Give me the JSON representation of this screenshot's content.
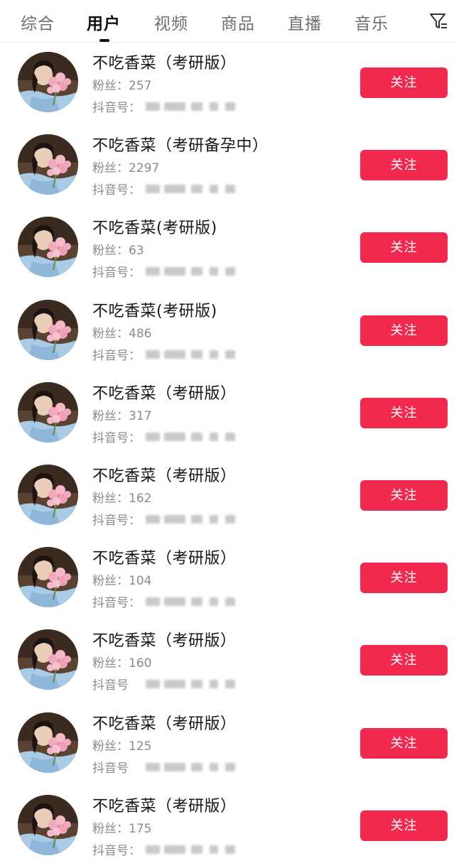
{
  "tabs": [
    {
      "label": "综合",
      "active": false
    },
    {
      "label": "用户",
      "active": true
    },
    {
      "label": "视频",
      "active": false
    },
    {
      "label": "商品",
      "active": false
    },
    {
      "label": "直播",
      "active": false
    },
    {
      "label": "音乐",
      "active": false
    }
  ],
  "filter_icon": "filter-icon",
  "follow_label": "关注",
  "colors": {
    "accent": "#f1294f",
    "text_primary": "#161616",
    "text_secondary": "#8a8a8a"
  },
  "users": [
    {
      "name": "不吃香菜（考研版）",
      "fans": "粉丝：257",
      "douyin_prefix": "抖音号："
    },
    {
      "name": "不吃香菜（考研备孕中）",
      "fans": "粉丝：2297",
      "douyin_prefix": "抖音号："
    },
    {
      "name": "不吃香菜(考研版)",
      "fans": "粉丝：63",
      "douyin_prefix": "抖音号："
    },
    {
      "name": "不吃香菜(考研版)",
      "fans": "粉丝：486",
      "douyin_prefix": "抖音号："
    },
    {
      "name": "不吃香菜（考研版）",
      "fans": "粉丝：317",
      "douyin_prefix": "抖音号："
    },
    {
      "name": "不吃香菜（考研版）",
      "fans": "粉丝：162",
      "douyin_prefix": "抖音号："
    },
    {
      "name": "不吃香菜（考研版）",
      "fans": "粉丝：104",
      "douyin_prefix": "抖音号："
    },
    {
      "name": "不吃香菜（考研版）",
      "fans": "粉丝：160",
      "douyin_prefix": "抖音号"
    },
    {
      "name": "不吃香菜（考研版）",
      "fans": "粉丝：125",
      "douyin_prefix": "抖音号"
    },
    {
      "name": "不吃香菜（考研版）",
      "fans": "粉丝：175",
      "douyin_prefix": "抖音号："
    }
  ]
}
